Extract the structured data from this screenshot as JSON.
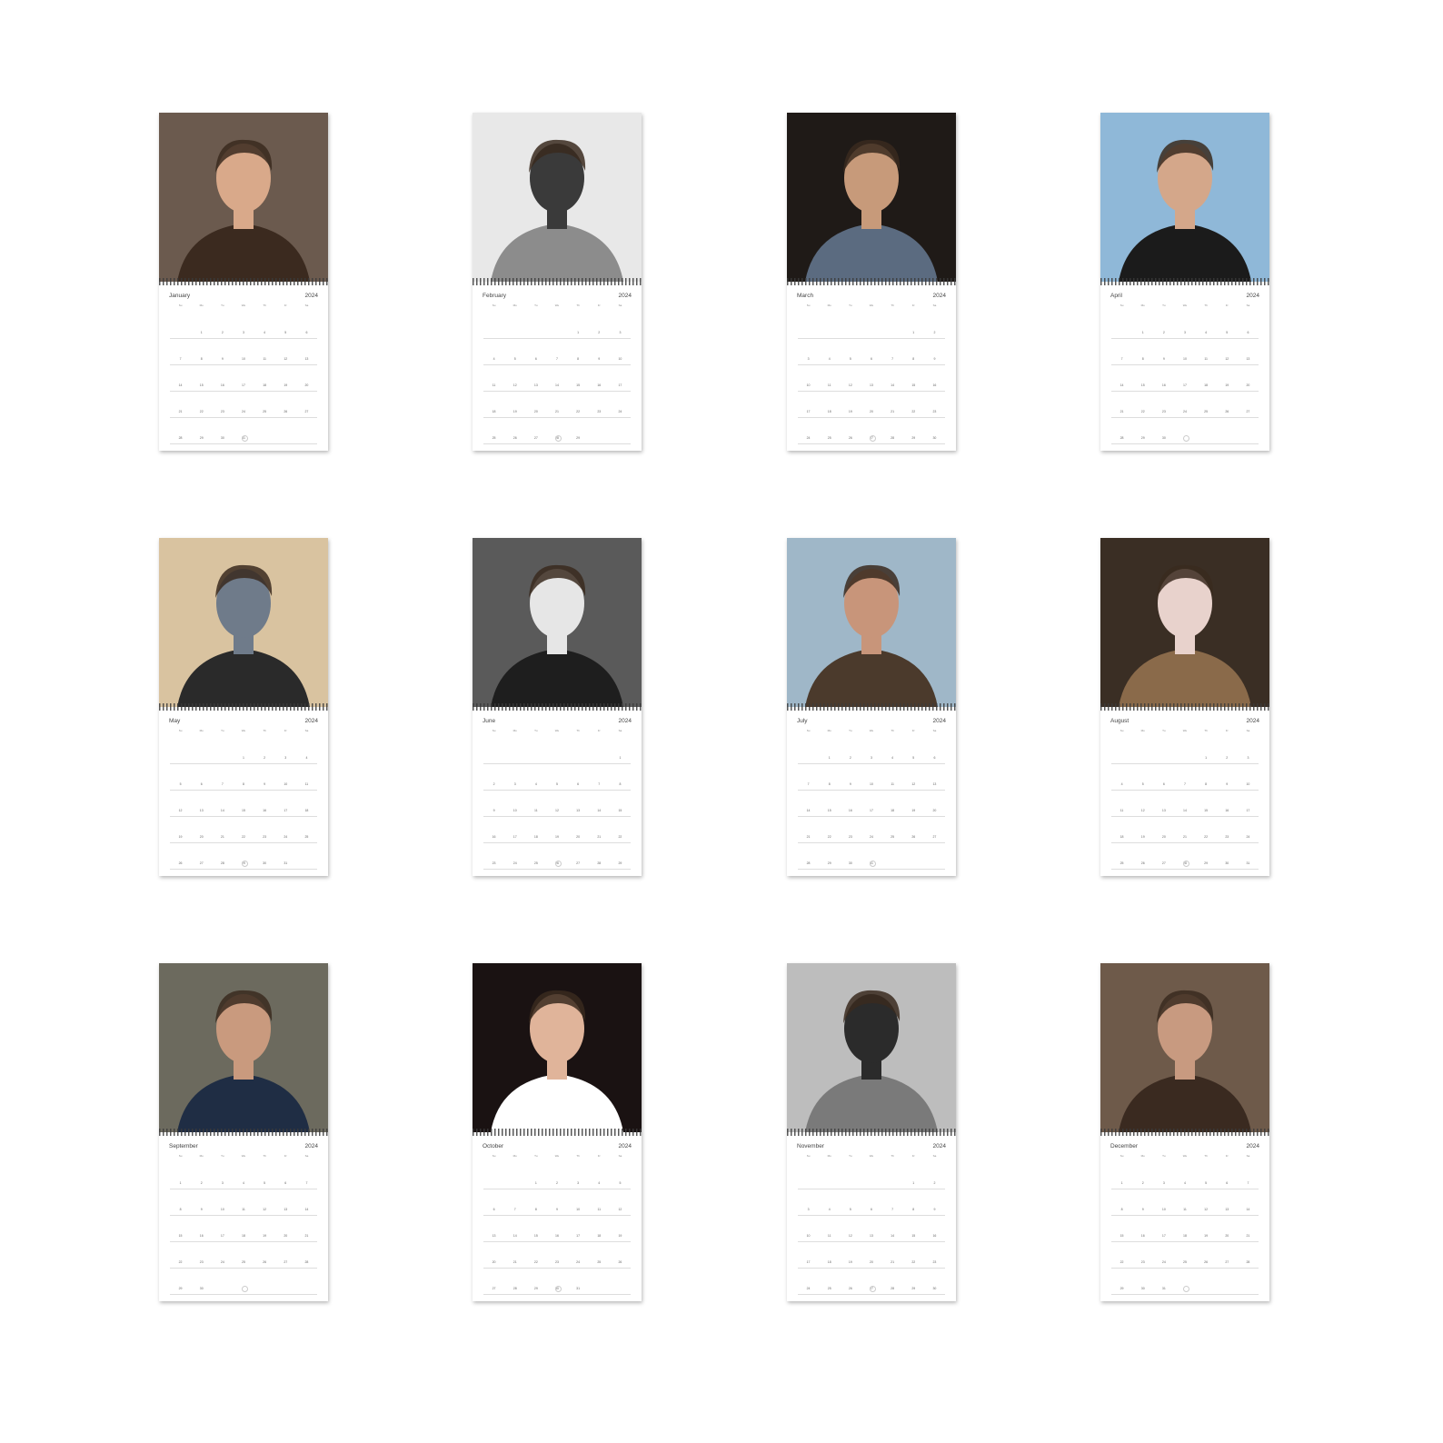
{
  "calendars": [
    {
      "month": "January",
      "year": "2024",
      "photo": "portrait-smiling-young-man",
      "palette": [
        "#6b5a4e",
        "#d9a98a",
        "#3b2a1f"
      ]
    },
    {
      "month": "February",
      "year": "2024",
      "photo": "bw-man-reclining-in-chair",
      "palette": [
        "#e8e8e8",
        "#3a3a3a",
        "#8c8c8c"
      ]
    },
    {
      "month": "March",
      "year": "2024",
      "photo": "man-in-blue-blazer",
      "palette": [
        "#1f1a17",
        "#c79a7a",
        "#5b6b80"
      ]
    },
    {
      "month": "April",
      "year": "2024",
      "photo": "man-in-tuxedo-blue-sky",
      "palette": [
        "#8fb8d8",
        "#d4a78a",
        "#1b1b1b"
      ]
    },
    {
      "month": "May",
      "year": "2024",
      "photo": "man-in-convertible-car",
      "palette": [
        "#d9c3a0",
        "#6f7b8a",
        "#2a2a2a"
      ]
    },
    {
      "month": "June",
      "year": "2024",
      "photo": "bw-young-man-with-swan",
      "palette": [
        "#5a5a5a",
        "#e6e6e6",
        "#1e1e1e"
      ]
    },
    {
      "month": "July",
      "year": "2024",
      "photo": "close-up-young-man",
      "palette": [
        "#9fb7c8",
        "#c8957a",
        "#4b3a2c"
      ]
    },
    {
      "month": "August",
      "year": "2024",
      "photo": "man-in-pink-suit-interior",
      "palette": [
        "#3a2e24",
        "#e8d2cc",
        "#8a6a4a"
      ]
    },
    {
      "month": "September",
      "year": "2024",
      "photo": "man-in-navy-sweater",
      "palette": [
        "#6c6a5e",
        "#c99a7e",
        "#1f2d44"
      ]
    },
    {
      "month": "October",
      "year": "2024",
      "photo": "young-man-dark-background",
      "palette": [
        "#1a1212",
        "#e0b49a",
        "#ffffff"
      ]
    },
    {
      "month": "November",
      "year": "2024",
      "photo": "bw-man-on-fire-escape",
      "palette": [
        "#bdbdbd",
        "#2b2b2b",
        "#7a7a7a"
      ]
    },
    {
      "month": "December",
      "year": "2024",
      "photo": "man-in-brown-coat",
      "palette": [
        "#6e5a4a",
        "#c89a80",
        "#3a2a20"
      ]
    }
  ],
  "weekdays": [
    "Su",
    "Mo",
    "Tu",
    "We",
    "Th",
    "Fr",
    "Sa"
  ]
}
